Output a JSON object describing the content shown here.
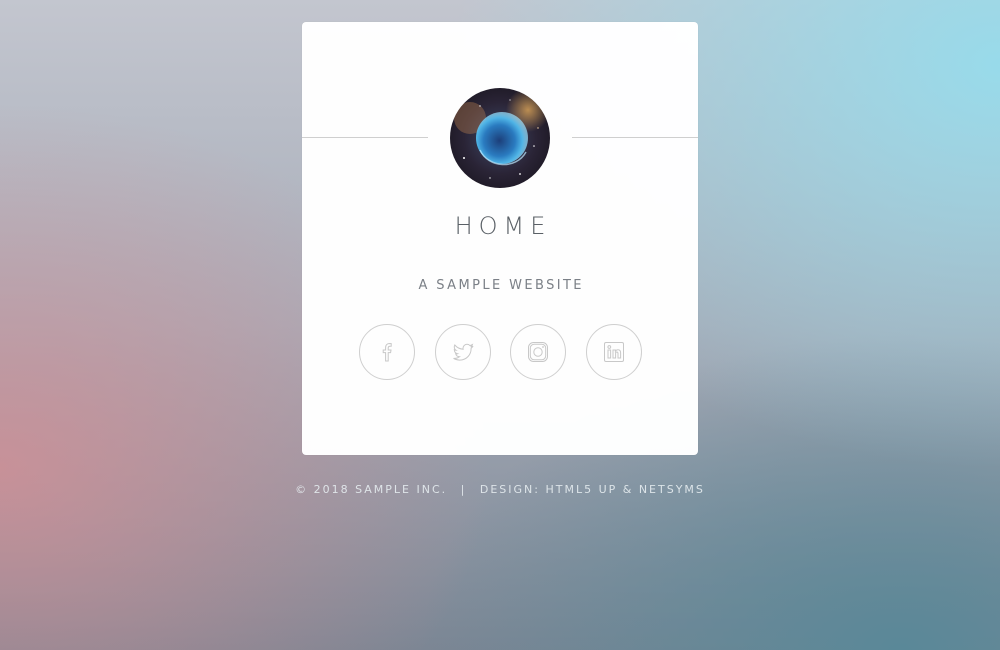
{
  "card": {
    "title": "HOME",
    "subtitle": "A SAMPLE WEBSITE",
    "avatar_icon": "nebula-image"
  },
  "social": [
    {
      "name": "facebook",
      "icon": "facebook-icon"
    },
    {
      "name": "twitter",
      "icon": "twitter-icon"
    },
    {
      "name": "instagram",
      "icon": "instagram-icon"
    },
    {
      "name": "linkedin",
      "icon": "linkedin-icon"
    }
  ],
  "footer": {
    "copyright": "© 2018 SAMPLE INC.",
    "separator": "|",
    "credit": "DESIGN: HTML5 UP & NETSYMS"
  },
  "colors": {
    "card_bg": "#ffffff",
    "title_text": "#5a6066",
    "icon_stroke": "#cfcfcf"
  }
}
